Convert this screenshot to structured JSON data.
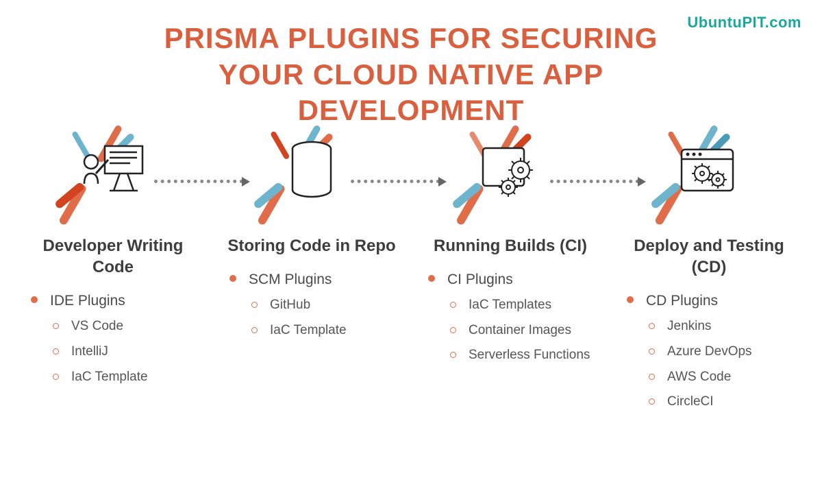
{
  "watermark": "UbuntuPIT.com",
  "title": "PRISMA PLUGINS FOR SECURING YOUR CLOUD NATIVE APP DEVELOPMENT",
  "stages": [
    {
      "title": "Developer Writing Code",
      "plugin": "IDE Plugins",
      "items": [
        "VS Code",
        "IntelliJ",
        "IaC Template"
      ]
    },
    {
      "title": "Storing Code in Repo",
      "plugin": "SCM Plugins",
      "items": [
        "GitHub",
        "IaC Template"
      ]
    },
    {
      "title": "Running Builds (CI)",
      "plugin": "CI Plugins",
      "items": [
        "IaC Templates",
        "Container Images",
        "Serverless Functions"
      ]
    },
    {
      "title": "Deploy and Testing (CD)",
      "plugin": "CD Plugins",
      "items": [
        "Jenkins",
        "Azure DevOps",
        "AWS Code",
        "CircleCI"
      ]
    }
  ]
}
